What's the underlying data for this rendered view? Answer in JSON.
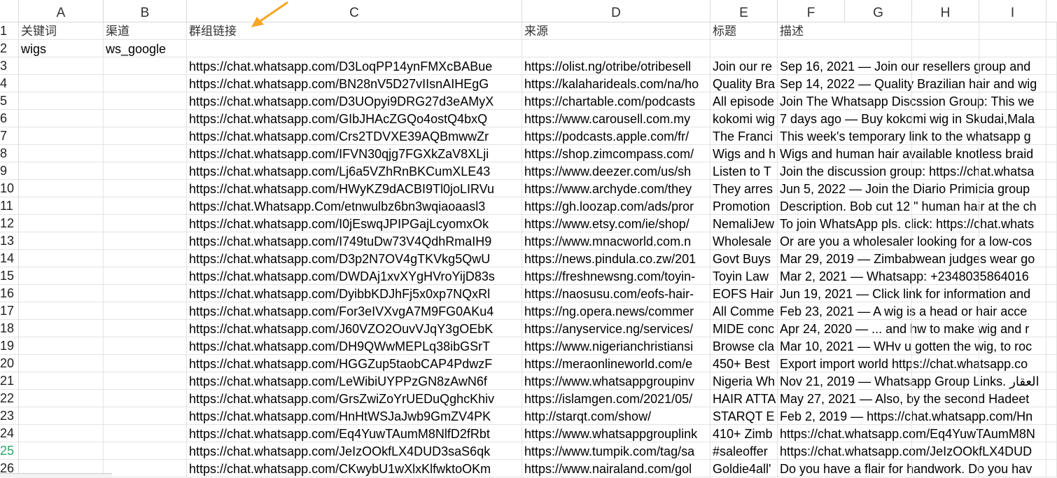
{
  "columns": [
    "A",
    "B",
    "C",
    "D",
    "E",
    "F",
    "G",
    "H",
    "I"
  ],
  "rows": [
    {
      "num": "1",
      "a": "关键词",
      "b": "渠道",
      "c": "群组链接",
      "d": "来源",
      "e": "标题",
      "f": "描述"
    },
    {
      "num": "2",
      "a": "wigs",
      "b": "ws_google",
      "c": "",
      "d": "",
      "e": "",
      "f": ""
    },
    {
      "num": "3",
      "a": "",
      "b": "",
      "c": "https://chat.whatsapp.com/D3LoqPP14ynFMXcBABue",
      "d": "https://olist.ng/otribe/otribesell",
      "e": "Join our re",
      "f": "Sep 16, 2021 — Join our resellers group and"
    },
    {
      "num": "4",
      "a": "",
      "b": "",
      "c": "https://chat.whatsapp.com/BN28nV5D27vIIsnAIHEgG",
      "d": "https://kalaharideals.com/na/ho",
      "e": "Quality Bra",
      "f": "Sep 14, 2022 — Quality Brazilian hair and wig"
    },
    {
      "num": "5",
      "a": "",
      "b": "",
      "c": "https://chat.whatsapp.com/D3UOpyi9DRG27d3eAMyX",
      "d": "https://chartable.com/podcasts",
      "e": "All episode",
      "f": "Join The Whatsapp Discssion Group: This we"
    },
    {
      "num": "6",
      "a": "",
      "b": "",
      "c": "https://chat.whatsapp.com/GIbJHAcZGQo4ostQ4bxQ",
      "d": "https://www.carousell.com.my",
      "e": "kokomi wig",
      "f": "7 days ago — Buy kokomi wig in Skudai,Mala"
    },
    {
      "num": "7",
      "a": "",
      "b": "",
      "c": "https://chat.whatsapp.com/Crs2TDVXE39AQBmwwZr",
      "d": "https://podcasts.apple.com/fr/",
      "e": "The Franci",
      "f": "This week's temporary link to the whatsapp g"
    },
    {
      "num": "8",
      "a": "",
      "b": "",
      "c": "https://chat.whatsapp.com/IFVN30qjg7FGXkZaV8XLji",
      "d": "https://shop.zimcompass.com/",
      "e": "Wigs and h",
      "f": "Wigs and human hair available knotless braid"
    },
    {
      "num": "9",
      "a": "",
      "b": "",
      "c": "https://chat.whatsapp.com/Lj6a5VZhRnBKCumXLE43",
      "d": "https://www.deezer.com/us/sh",
      "e": "Listen to T",
      "f": "Join the discussion group: https://chat.whatsa"
    },
    {
      "num": "10",
      "a": "",
      "b": "",
      "c": "https://chat.whatsapp.com/HWyKZ9dACBI9Tl0joLIRVu",
      "d": "https://www.archyde.com/they",
      "e": "They arres",
      "f": "Jun 5, 2022 — Join the Diario Primicia group"
    },
    {
      "num": "11",
      "a": "",
      "b": "",
      "c": "https://chat.Whatsapp.Com/etnwulbz6bn3wqiaoaasl3",
      "d": "https://gh.loozap.com/ads/pror",
      "e": "Promotion",
      "f": "Description. Bob cut 12 \" human hair at the ch"
    },
    {
      "num": "12",
      "a": "",
      "b": "",
      "c": "https://chat.whatsapp.com/I0jEswqJPIPGajLcyomxOk",
      "d": "https://www.etsy.com/ie/shop/",
      "e": "NemaliJew",
      "f": "To join WhatsApp pls. click: https://chat.whats"
    },
    {
      "num": "13",
      "a": "",
      "b": "",
      "c": "https://chat.whatsapp.com/I749tuDw73V4QdhRmaIH9",
      "d": "https://www.mnacworld.com.n",
      "e": "Wholesale",
      "f": "Or are you a wholesaler looking for a low-cos"
    },
    {
      "num": "14",
      "a": "",
      "b": "",
      "c": "https://chat.whatsapp.com/D3p2N7OV4gTKVkg5QwU",
      "d": "https://news.pindula.co.zw/201",
      "e": "Govt Buys",
      "f": "Mar 29, 2019 — Zimbabwean judges wear go"
    },
    {
      "num": "15",
      "a": "",
      "b": "",
      "c": "https://chat.whatsapp.com/DWDAj1xvXYgHVroYijD83s",
      "d": "https://freshnewsng.com/toyin-",
      "e": "Toyin Law",
      "f": "Mar 2, 2021 — Whatsapp: +2348035864016"
    },
    {
      "num": "16",
      "a": "",
      "b": "",
      "c": "https://chat.whatsapp.com/DyibbKDJhFj5x0xp7NQxRl",
      "d": "https://naosusu.com/eofs-hair-",
      "e": "EOFS Hair",
      "f": "Jun 19, 2021 — Click link for information and"
    },
    {
      "num": "17",
      "a": "",
      "b": "",
      "c": "https://chat.whatsapp.com/For3eIVXvgA7M9FG0AKu4",
      "d": "https://ng.opera.news/commer",
      "e": "All Comme",
      "f": "Feb 23, 2021 — A wig is a head or hair acce"
    },
    {
      "num": "18",
      "a": "",
      "b": "",
      "c": "https://chat.whatsapp.com/J60VZO2OuvVJqY3gOEbK",
      "d": "https://anyservice.ng/services/",
      "e": "MIDE conc",
      "f": "Apr 24, 2020 — ... and hw to make wig and r"
    },
    {
      "num": "19",
      "a": "",
      "b": "",
      "c": "https://chat.whatsapp.com/DH9QWwMEPLq38ibGSrT",
      "d": "https://www.nigerianchristiansi",
      "e": "Browse cla",
      "f": "Mar 10, 2021 — WHv u gotten the wig, to roc"
    },
    {
      "num": "20",
      "a": "",
      "b": "",
      "c": "https://chat.whatsapp.com/HGGZup5taobCAP4PdwzF",
      "d": "https://meraonlineworld.com/e",
      "e": "450+ Best",
      "f": "Export import world https://chat.whatsapp.co"
    },
    {
      "num": "21",
      "a": "",
      "b": "",
      "c": "https://chat.whatsapp.com/LeWibiUYPPzGN8zAwN6f",
      "d": "https://www.whatsappgroupinv",
      "e": "Nigeria Wh",
      "f": "Nov 21, 2019 — Whatsapp Group Links. العقار"
    },
    {
      "num": "22",
      "a": "",
      "b": "",
      "c": "https://chat.whatsapp.com/GrsZwiZoYrUEDuQghcKhiv",
      "d": "https://islamgen.com/2021/05/",
      "e": "HAIR ATTA",
      "f": "May 27, 2021 — Also, by the second Hadeet"
    },
    {
      "num": "23",
      "a": "",
      "b": "",
      "c": "https://chat.whatsapp.com/HnHtWSJaJwb9GmZV4PK",
      "d": "http://starqt.com/show/",
      "e": "STARQT E",
      "f": "Feb 2, 2019 — https://chat.whatsapp.com/Hn"
    },
    {
      "num": "24",
      "a": "",
      "b": "",
      "c": "https://chat.whatsapp.com/Eq4YuwTAumM8NlfD2fRbt",
      "d": "https://www.whatsappgrouplink",
      "e": "410+ Zimb",
      "f": "https://chat.whatsapp.com/Eq4YuwTAumM8N"
    },
    {
      "num": "25",
      "a": "",
      "b": "",
      "c": "https://chat.whatsapp.com/JeIzOOkfLX4DUD3saS6qk",
      "d": "https://www.tumpik.com/tag/sa",
      "e": "#saleoffer",
      "f": "https://chat.whatsapp.com/JeIzOOkfLX4DUD"
    },
    {
      "num": "26",
      "a": "",
      "b": "",
      "c": "https://chat.whatsapp.com/CKwybU1wXlxKlfwktoOKm",
      "d": "https://www.nairaland.com/gol",
      "e": "Goldie4all'",
      "f": "Do you have a flair for handwork. Do you hav"
    }
  ],
  "active_row": "25",
  "accent_color": "#2fa36b",
  "annotation_arrow_color": "#f5a623"
}
